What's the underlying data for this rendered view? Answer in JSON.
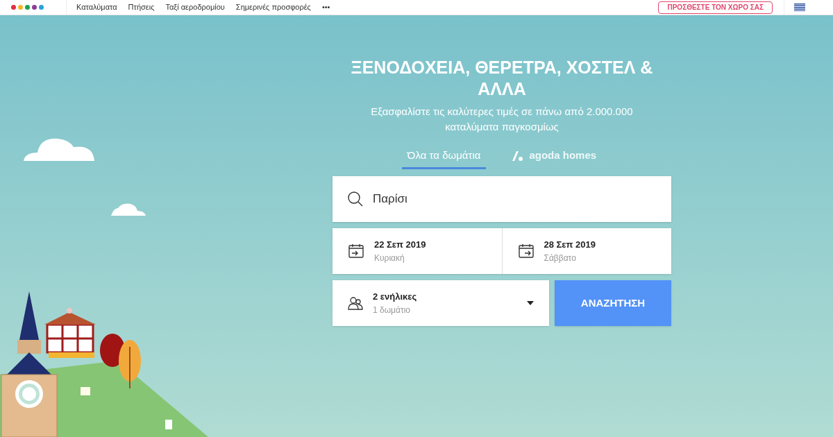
{
  "header": {
    "nav": [
      {
        "label": "Καταλύματα"
      },
      {
        "label": "Πτήσεις"
      },
      {
        "label": "Ταξί αεροδρομίου"
      },
      {
        "label": "Σημερινές προσφορές"
      },
      {
        "label": "•••"
      }
    ],
    "list_button": "ΠΡΟΣΘΕΣΤΕ ΤΟΝ ΧΩΡΟ ΣΑΣ"
  },
  "hero": {
    "title": "ΞΕΝΟΔΟΧΕΙΑ, ΘΕΡΕΤΡΑ, ΧΟΣΤΕΛ & ΑΛΛΑ",
    "subtitle": "Εξασφαλίστε τις καλύτερες τιμές σε πάνω από 2.000.000 καταλύματα παγκοσμίως"
  },
  "tabs": [
    {
      "label": "Όλα τα δωμάτια",
      "selected": true,
      "kind": "plain"
    },
    {
      "label": "agoda homes",
      "selected": false,
      "kind": "homes"
    }
  ],
  "search": {
    "value": "Παρίσι"
  },
  "dates": [
    {
      "kind": "checkin",
      "date": "22 Σεπ 2019",
      "day": "Κυριακή"
    },
    {
      "kind": "checkout",
      "date": "28 Σεπ 2019",
      "day": "Σάββατο"
    }
  ],
  "guests": {
    "adults": "2 ενήλικες",
    "rooms": "1 δωμάτιο"
  },
  "search_button": "ΑΝΑΖΗΤΗΣΗ"
}
